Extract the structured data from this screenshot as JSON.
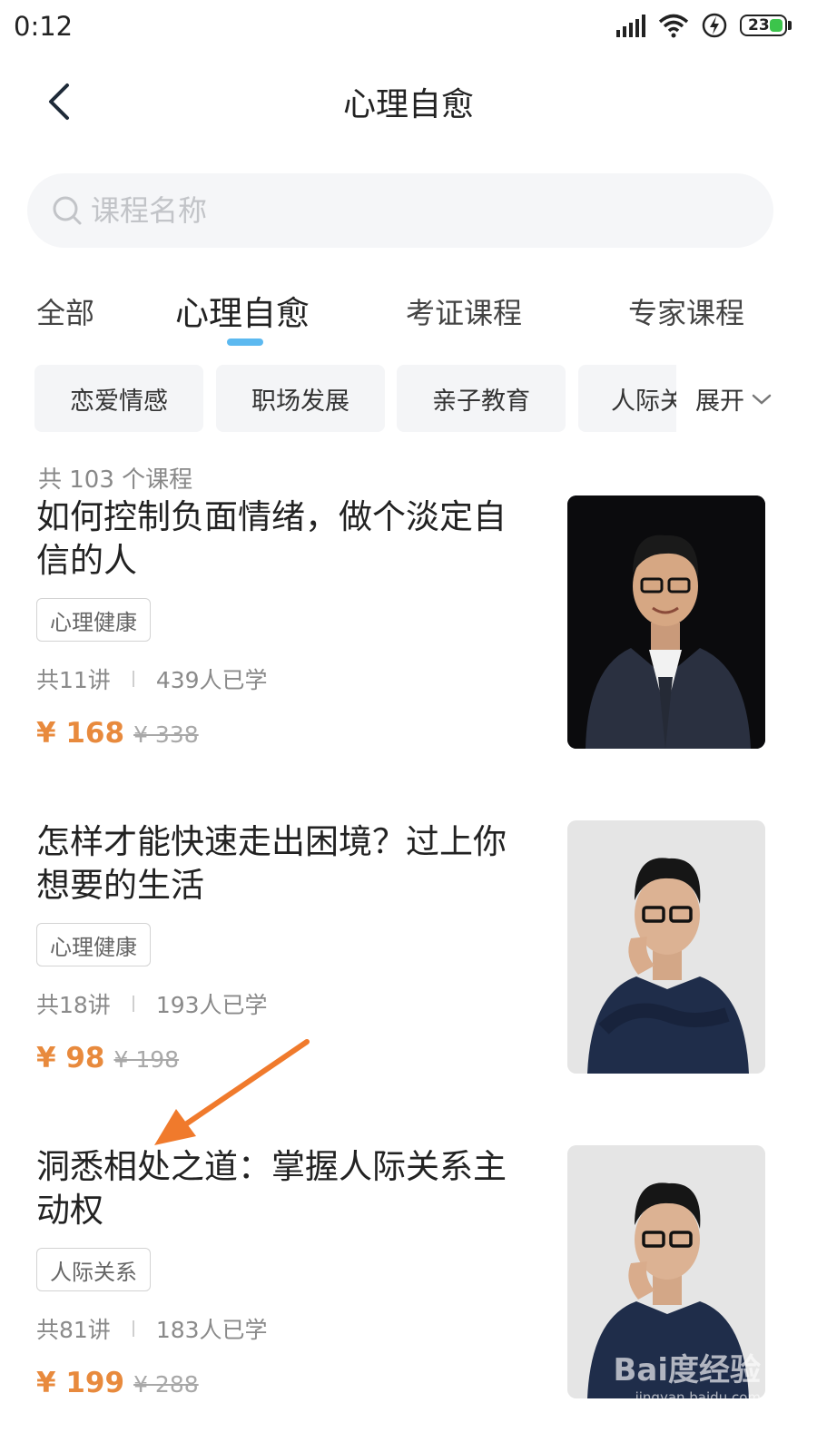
{
  "status_bar": {
    "time": "0:12",
    "battery": "23"
  },
  "header": {
    "title": "心理自愈"
  },
  "search": {
    "placeholder": "课程名称"
  },
  "tabs": [
    {
      "label": "全部"
    },
    {
      "label": "心理自愈",
      "active": true
    },
    {
      "label": "考证课程"
    },
    {
      "label": "专家课程"
    }
  ],
  "chips": [
    "恋爱情感",
    "职场发展",
    "亲子教育",
    "人际关系"
  ],
  "expand_label": "展开",
  "count_label": "共 103 个课程",
  "courses": [
    {
      "title": "如何控制负面情绪，做个淡定自信的人",
      "tag": "心理健康",
      "lessons": "共11讲",
      "learners": "439人已学",
      "price": "¥ 168",
      "original_price": "¥ 338"
    },
    {
      "title": "怎样才能快速走出困境？过上你想要的生活",
      "tag": "心理健康",
      "lessons": "共18讲",
      "learners": "193人已学",
      "price": "¥ 98",
      "original_price": "¥ 198"
    },
    {
      "title": "洞悉相处之道：掌握人际关系主动权",
      "tag": "人际关系",
      "lessons": "共81讲",
      "learners": "183人已学",
      "price": "¥ 199",
      "original_price": "¥ 288"
    }
  ],
  "watermark": {
    "main": "Bai度经验",
    "sub": "jingyan.baidu.com"
  },
  "colors": {
    "accent_price": "#e88a3d",
    "tab_indicator": "#5cb9f0",
    "annotation_arrow": "#f07a2c"
  }
}
